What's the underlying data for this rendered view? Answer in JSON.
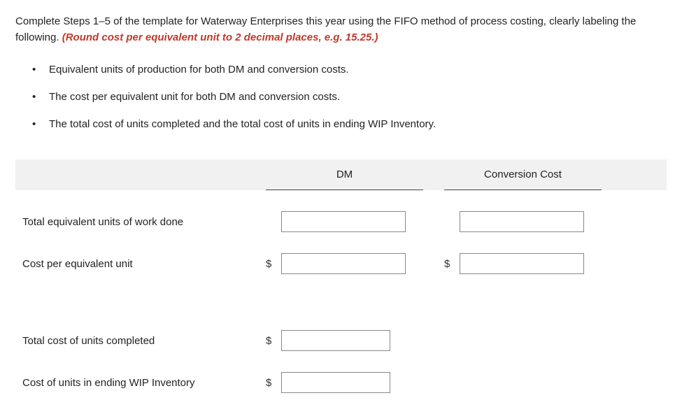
{
  "instructions": {
    "main": "Complete Steps 1–5 of the template for Waterway Enterprises this year using the FIFO method of process costing, clearly labeling the following.",
    "hint": "(Round cost per equivalent unit to 2 decimal places, e.g. 15.25.)"
  },
  "bullets": [
    "Equivalent units of production for both DM and conversion costs.",
    "The cost per equivalent unit for both DM and conversion costs.",
    "The total cost of units completed and the total cost of units in ending WIP Inventory."
  ],
  "table": {
    "headers": {
      "dm": "DM",
      "conversion": "Conversion Cost"
    },
    "rows": {
      "r1": {
        "label": "Total equivalent units of work done",
        "dm": "",
        "cc": ""
      },
      "r2": {
        "label": "Cost per equivalent unit",
        "dm": "",
        "cc": "",
        "currency": "$"
      },
      "r3": {
        "label": "Total cost of units completed",
        "val": "",
        "currency": "$"
      },
      "r4": {
        "label": "Cost of units in ending WIP Inventory",
        "val": "",
        "currency": "$"
      }
    }
  }
}
